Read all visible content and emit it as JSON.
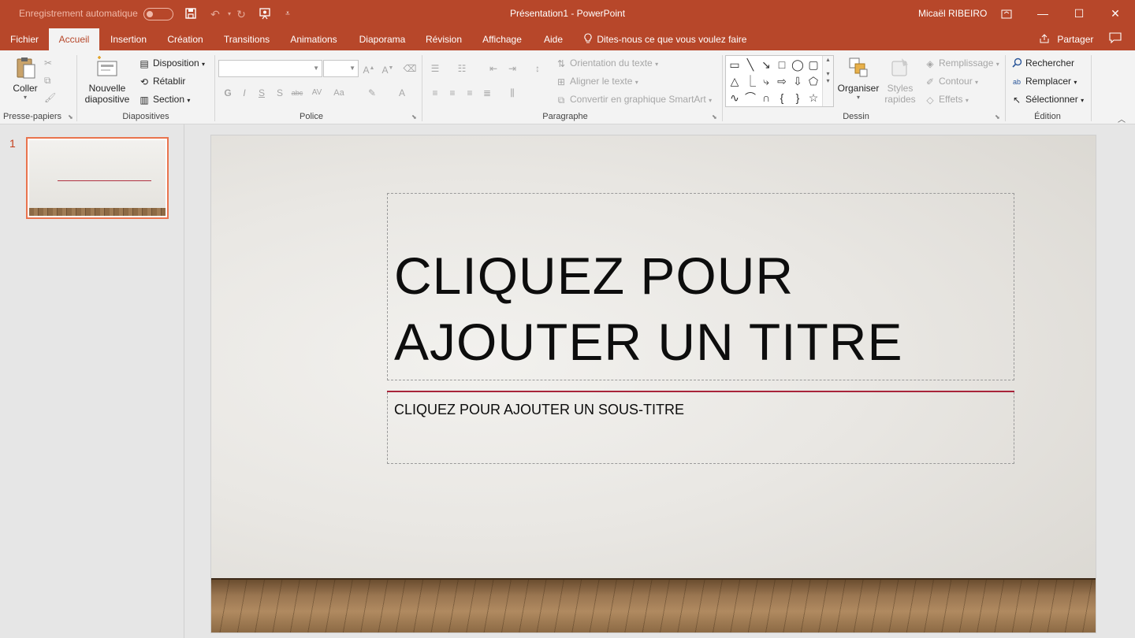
{
  "titlebar": {
    "autosave_label": "Enregistrement automatique",
    "window_title": "Présentation1  -  PowerPoint",
    "user_name": "Micaël RIBEIRO"
  },
  "tabs": [
    "Fichier",
    "Accueil",
    "Insertion",
    "Création",
    "Transitions",
    "Animations",
    "Diaporama",
    "Révision",
    "Affichage",
    "Aide"
  ],
  "active_tab": "Accueil",
  "tellme_label": "Dites-nous ce que vous voulez faire",
  "share_label": "Partager",
  "ribbon": {
    "clipboard": {
      "paste": "Coller",
      "group": "Presse-papiers"
    },
    "slides": {
      "new_slide_line1": "Nouvelle",
      "new_slide_line2": "diapositive",
      "layout": "Disposition",
      "reset": "Rétablir",
      "section": "Section",
      "group": "Diapositives"
    },
    "font": {
      "group": "Police",
      "font_name": "",
      "font_size": ""
    },
    "paragraph": {
      "text_direction": "Orientation du texte",
      "align_text": "Aligner le texte",
      "smartart": "Convertir en graphique SmartArt",
      "group": "Paragraphe"
    },
    "drawing": {
      "arrange": "Organiser",
      "quick_styles_line1": "Styles",
      "quick_styles_line2": "rapides",
      "fill": "Remplissage",
      "outline": "Contour",
      "effects": "Effets",
      "group": "Dessin"
    },
    "editing": {
      "find": "Rechercher",
      "replace": "Remplacer",
      "select": "Sélectionner",
      "group": "Édition"
    }
  },
  "thumbnails": [
    {
      "number": "1"
    }
  ],
  "slide": {
    "title_line1": "CLIQUEZ POUR",
    "title_line2": "AJOUTER UN TITRE",
    "subtitle": "CLIQUEZ POUR AJOUTER UN SOUS-TITRE"
  },
  "colors": {
    "accent": "#b7472a",
    "tab_active_text": "#b7472a",
    "slide_accent_line": "#a8243a"
  }
}
